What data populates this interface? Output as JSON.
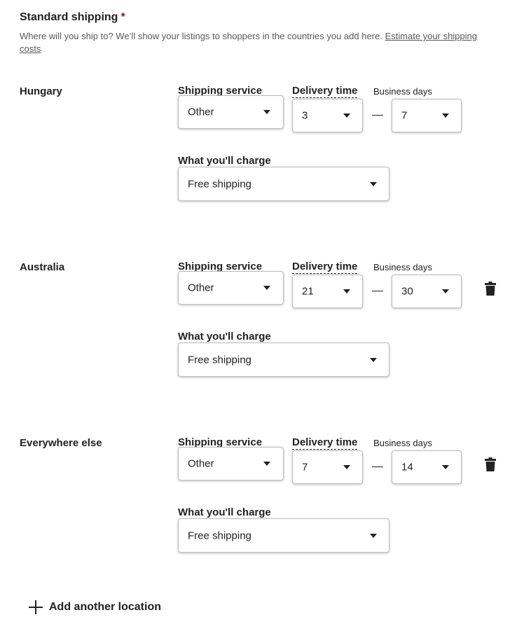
{
  "section": {
    "title": "Standard shipping",
    "required_mark": "*",
    "description": "Where will you ship to? We’ll show your listings to shoppers in the countries you add here.",
    "link": "Estimate your shipping costs"
  },
  "labels": {
    "shipping_service": "Shipping service",
    "delivery_time": "Delivery time",
    "business_days": "Business days",
    "what_you_charge": "What you'll charge"
  },
  "locations": [
    {
      "name": "Hungary",
      "service": "Other",
      "min_days": "3",
      "max_days": "7",
      "charge": "Free shipping",
      "deletable": false
    },
    {
      "name": "Australia",
      "service": "Other",
      "min_days": "21",
      "max_days": "30",
      "charge": "Free shipping",
      "deletable": true
    },
    {
      "name": "Everywhere else",
      "service": "Other",
      "min_days": "7",
      "max_days": "14",
      "charge": "Free shipping",
      "deletable": true
    }
  ],
  "add_location": {
    "label": "Add another location",
    "icon": "plus-icon"
  },
  "colors": {
    "required": "#8a1538",
    "text": "#222222",
    "muted": "#595959"
  },
  "icons": {
    "dropdown": "caret-down-icon",
    "delete": "trash-icon"
  }
}
